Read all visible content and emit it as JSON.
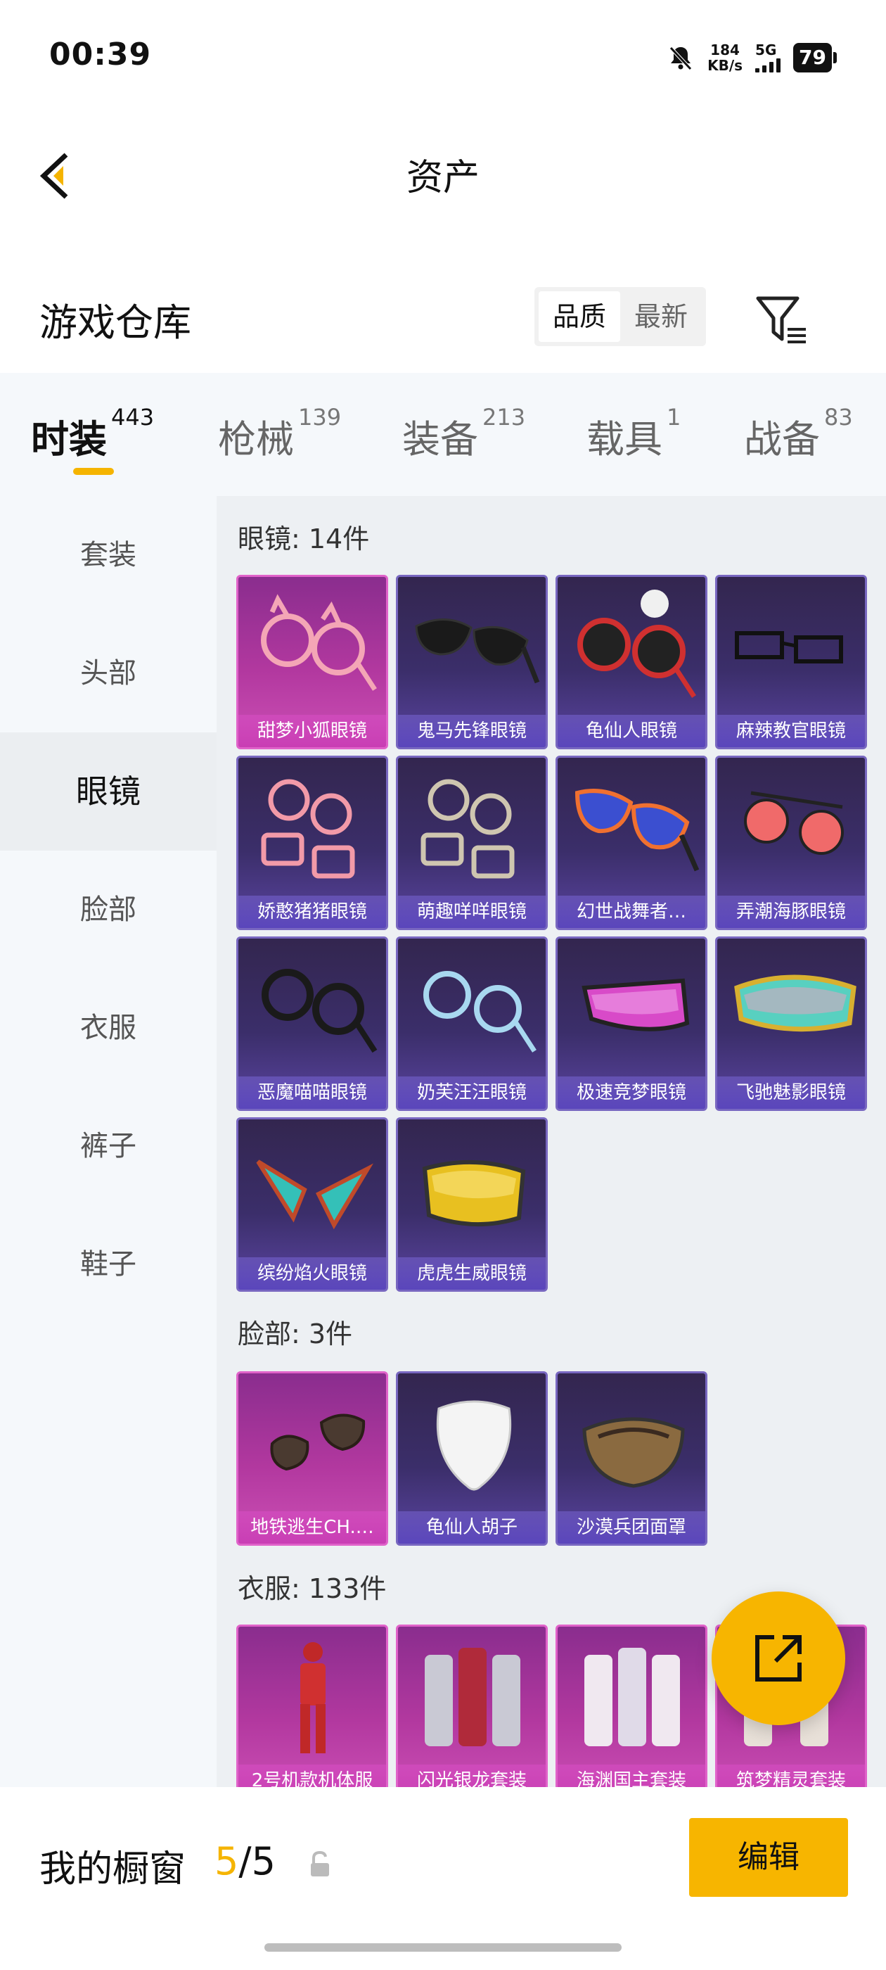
{
  "status": {
    "time": "00:39",
    "speed_value": "184",
    "speed_unit": "KB/s",
    "network": "5G",
    "battery": "79"
  },
  "header": {
    "title": "资产"
  },
  "warehouse": {
    "title": "游戏仓库",
    "sort_options": [
      "品质",
      "最新"
    ],
    "sort_active": "品质"
  },
  "tabs": [
    {
      "label": "时装",
      "count": "443"
    },
    {
      "label": "枪械",
      "count": "139"
    },
    {
      "label": "装备",
      "count": "213"
    },
    {
      "label": "载具",
      "count": "1"
    },
    {
      "label": "战备",
      "count": "83"
    }
  ],
  "sidebar": [
    "套装",
    "头部",
    "眼镜",
    "脸部",
    "衣服",
    "裤子",
    "鞋子"
  ],
  "sections": {
    "glasses": {
      "title": "眼镜: 14件",
      "items": [
        "甜梦小狐眼镜",
        "鬼马先锋眼镜",
        "龟仙人眼镜",
        "麻辣教官眼镜",
        "娇憨猪猪眼镜",
        "萌趣咩咩眼镜",
        "幻世战舞者…",
        "弄潮海豚眼镜",
        "恶魔喵喵眼镜",
        "奶芙汪汪眼镜",
        "极速竞梦眼镜",
        "飞驰魅影眼镜",
        "缤纷焰火眼镜",
        "虎虎生威眼镜"
      ]
    },
    "face": {
      "title": "脸部: 3件",
      "items": [
        "地铁逃生CH.…",
        "龟仙人胡子",
        "沙漠兵团面罩"
      ]
    },
    "clothes": {
      "title": "衣服: 133件",
      "items": [
        "2号机款机体服",
        "闪光银龙套装",
        "海渊国主套装",
        "筑梦精灵套装"
      ]
    }
  },
  "bottom": {
    "label": "我的橱窗",
    "count_current": "5",
    "count_sep": "/",
    "count_total": "5",
    "edit_label": "编辑"
  },
  "colors": {
    "accent": "#f7b500",
    "card_purple": "#3b2e6a",
    "card_pink": "#b2389f"
  }
}
